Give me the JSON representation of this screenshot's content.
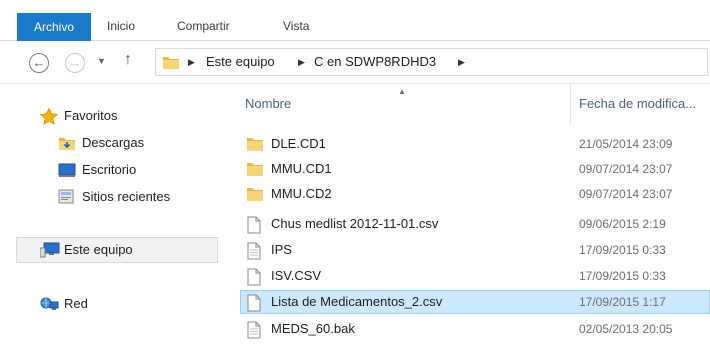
{
  "ribbon": {
    "tabs": [
      {
        "label": "Archivo"
      },
      {
        "label": "Inicio"
      },
      {
        "label": "Compartir"
      },
      {
        "label": "Vista"
      }
    ]
  },
  "address": {
    "crumbs": [
      "Este equipo",
      "C en SDWP8RDHD3"
    ]
  },
  "nav": {
    "favorites_label": "Favoritos",
    "downloads_label": "Descargas",
    "desktop_label": "Escritorio",
    "recent_label": "Sitios recientes",
    "this_pc_label": "Este equipo",
    "network_label": "Red"
  },
  "files": {
    "header_name": "Nombre",
    "header_date": "Fecha de modifica...",
    "rows": [
      {
        "name": "DLE.CD1",
        "date": "21/05/2014 23:09",
        "type": "folder"
      },
      {
        "name": "MMU.CD1",
        "date": "09/07/2014 23:07",
        "type": "folder"
      },
      {
        "name": "MMU.CD2",
        "date": "09/07/2014 23:07",
        "type": "folder"
      },
      {
        "name": "Chus medlist 2012-11-01.csv",
        "date": "09/06/2015 2:19",
        "type": "file"
      },
      {
        "name": "IPS",
        "date": "17/09/2015 0:33",
        "type": "file"
      },
      {
        "name": "ISV.CSV",
        "date": "17/09/2015 0:33",
        "type": "file"
      },
      {
        "name": "Lista de Medicamentos_2.csv",
        "date": "17/09/2015 1:17",
        "type": "file",
        "selected": true
      },
      {
        "name": "MEDS_60.bak",
        "date": "02/05/2013 20:05",
        "type": "file"
      }
    ]
  },
  "colors": {
    "file_tab": "#1979ca",
    "selection": "#cce8ff",
    "selection_border": "#99d1ff",
    "folder": "#e8b84a"
  }
}
